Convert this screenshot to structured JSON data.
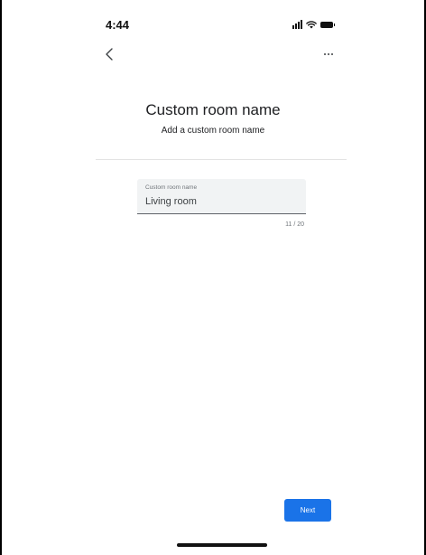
{
  "status_bar": {
    "time": "4:44"
  },
  "nav": {
    "back_icon": "chevron-left-icon",
    "more_icon": "more-horizontal-icon"
  },
  "header": {
    "title": "Custom room name",
    "subtitle": "Add a custom room name"
  },
  "form": {
    "field_label": "Custom room name",
    "field_value": "Living room",
    "counter": "11 / 20"
  },
  "footer": {
    "next_label": "Next"
  },
  "colors": {
    "accent": "#1a73e8",
    "field_background": "#f1f3f4"
  }
}
